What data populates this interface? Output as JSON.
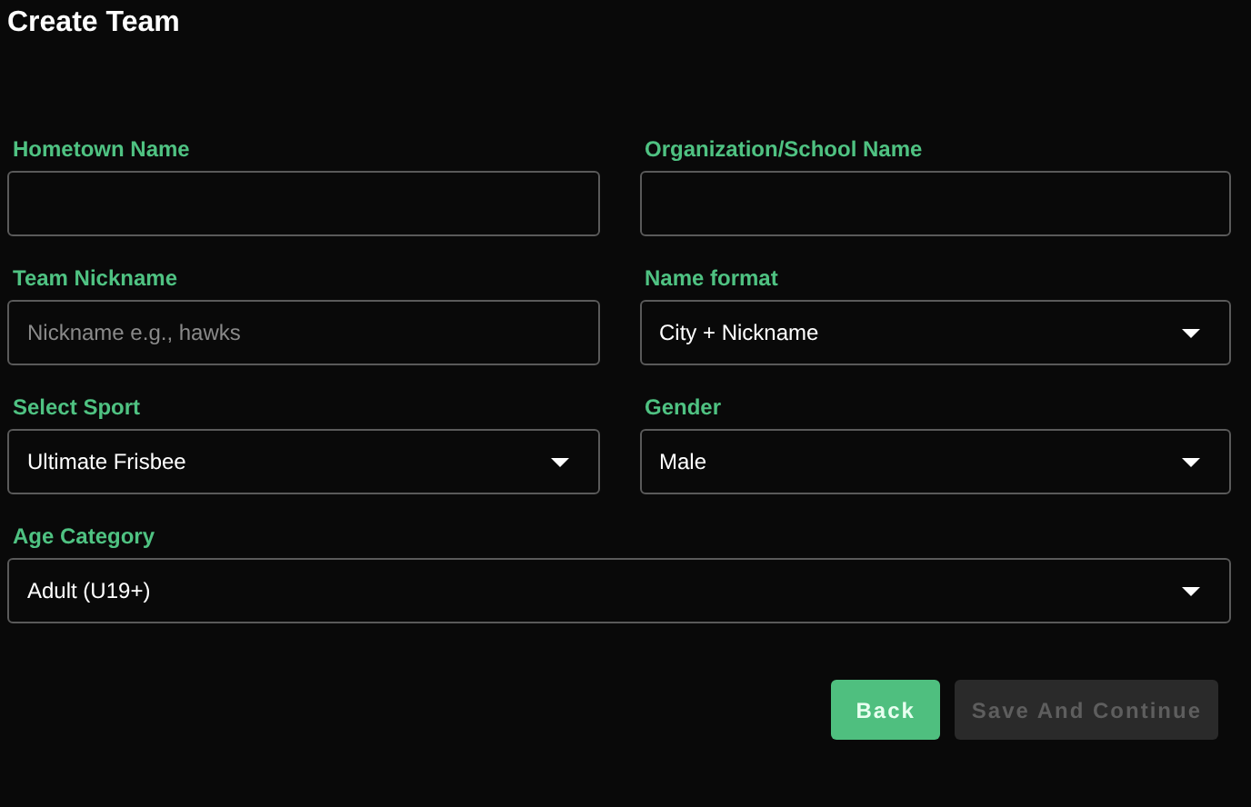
{
  "title": "Create Team",
  "rows": [
    [
      {
        "label": "Hometown Name",
        "kind": "text"
      },
      {
        "label": "Organization/School Name",
        "kind": "text"
      }
    ],
    [
      {
        "label": "Team Nickname",
        "kind": "text",
        "placeholder": "Nickname e.g., hawks"
      },
      {
        "label": "Name format",
        "kind": "select",
        "value": "City + Nickname"
      }
    ],
    [
      {
        "label": "Select Sport",
        "kind": "select",
        "value": "Ultimate Frisbee"
      },
      {
        "label": "Gender",
        "kind": "select",
        "value": "Male"
      }
    ],
    [
      {
        "label": "Age Category",
        "kind": "select",
        "value": "Adult (U19+)"
      }
    ]
  ],
  "buttons": [
    {
      "label": "Back",
      "disabled": false
    },
    {
      "label": "Save And Continue",
      "disabled": true
    }
  ]
}
